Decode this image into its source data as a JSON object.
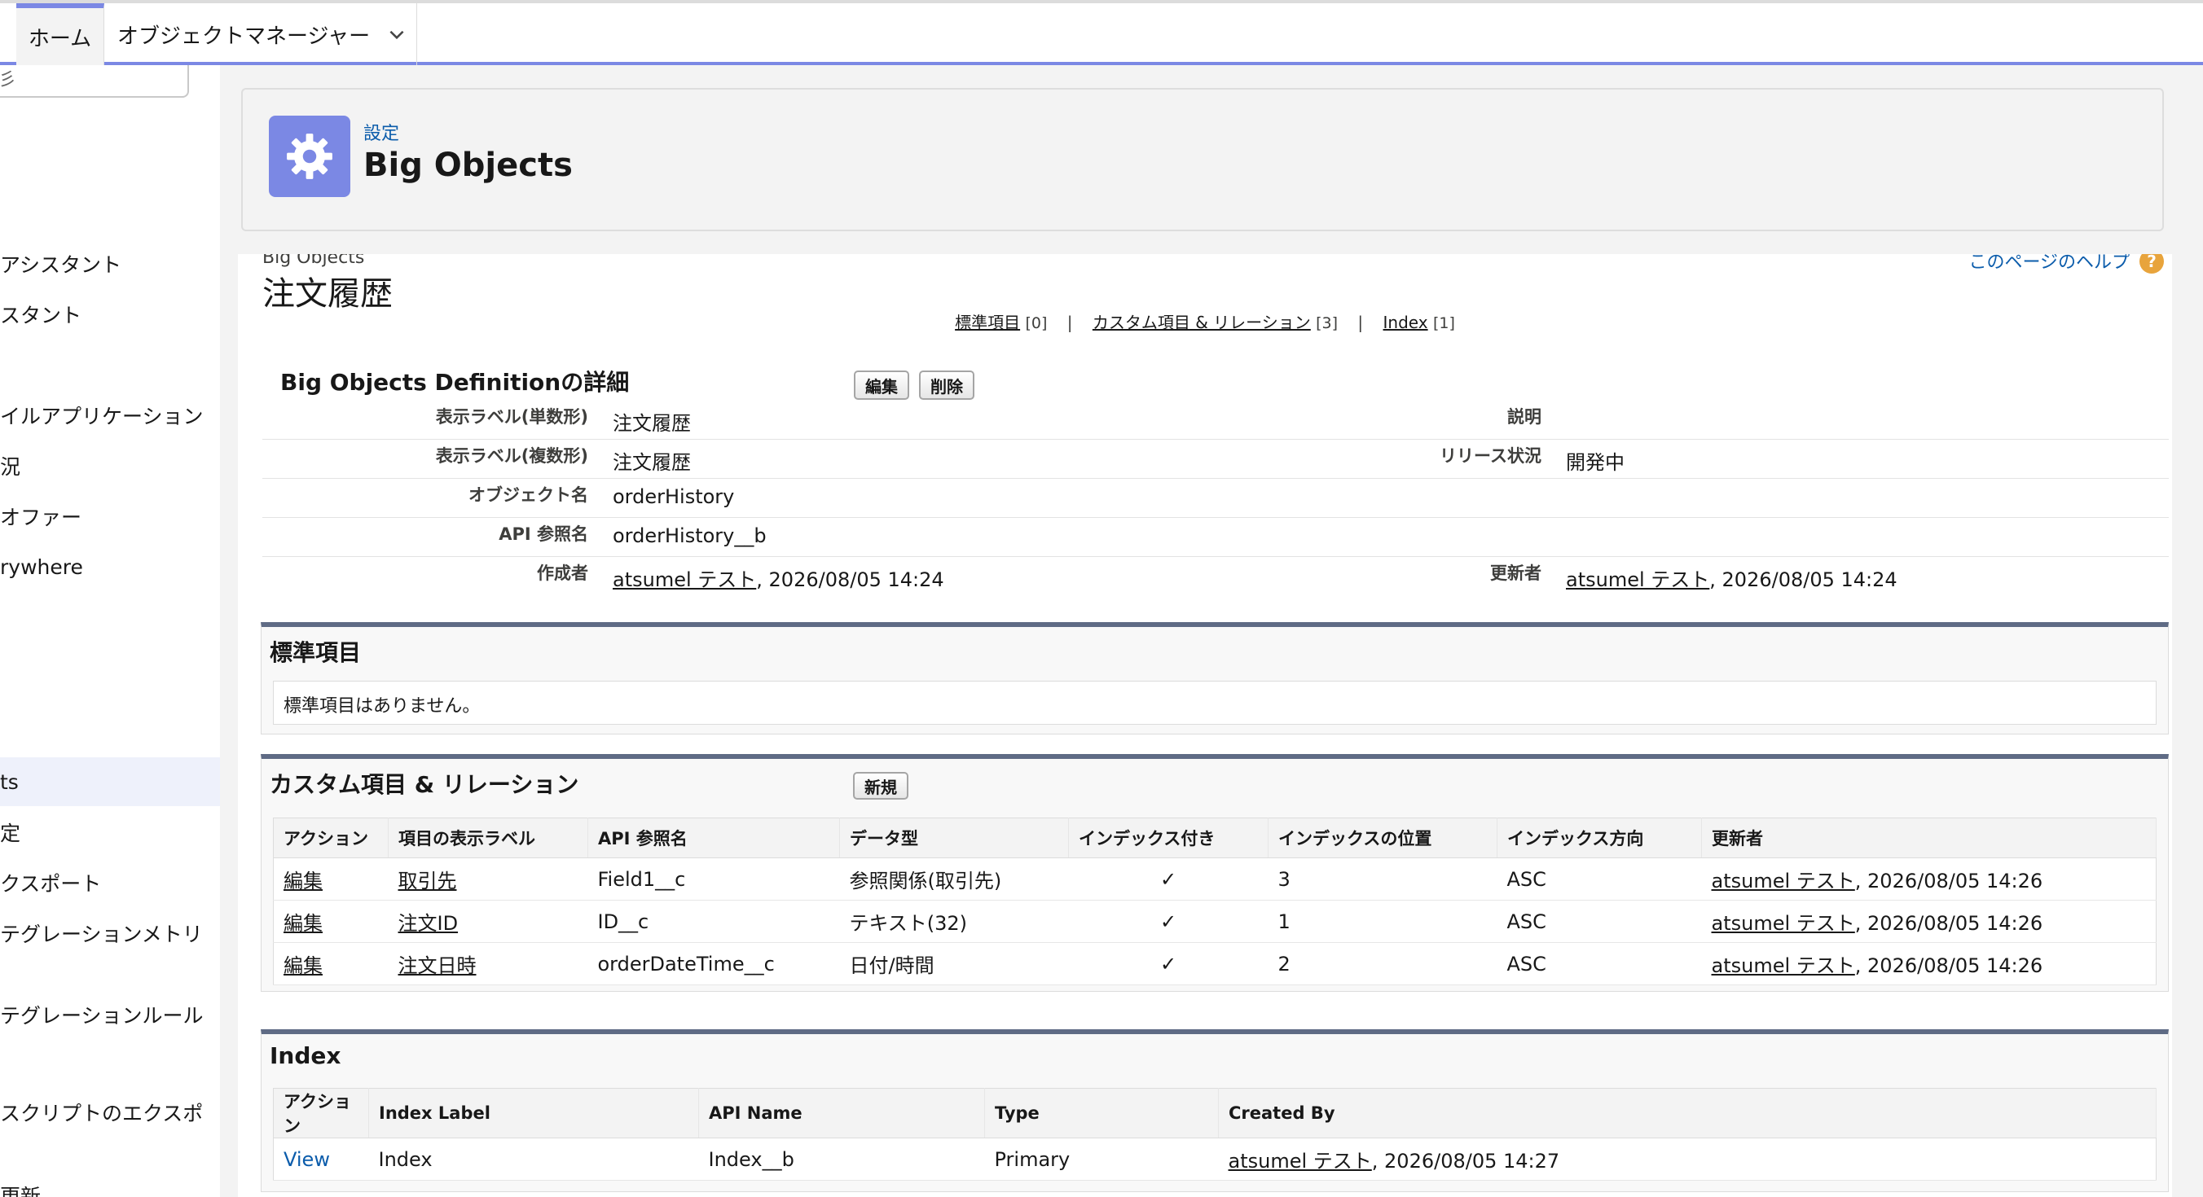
{
  "tabs": {
    "home": "ホーム",
    "object_manager": "オブジェクトマネージャー"
  },
  "sidebar": {
    "search_text": "彡",
    "items": [
      {
        "label": "アシスタント"
      },
      {
        "label": "スタント"
      },
      {
        "label": "イルアプリケーション"
      },
      {
        "label": "況"
      },
      {
        "label": "オファー"
      },
      {
        "label": "rywhere"
      },
      {
        "label": "ts"
      },
      {
        "label": "定"
      },
      {
        "label": "クスポート"
      },
      {
        "label": "テグレーションメトリ"
      },
      {
        "label": "テグレーションルール"
      },
      {
        "label": "スクリプトのエクスポ"
      },
      {
        "label": "更新"
      }
    ]
  },
  "header": {
    "breadcrumb": "設定",
    "title": "Big Objects",
    "icon": "gear-icon",
    "icon_color": "#7b88e4"
  },
  "object": {
    "small_label": "Big Objects",
    "title": "注文履歴",
    "help_link": "このページのヘルプ",
    "related_links": [
      {
        "label": "標準項目",
        "count": "[0]"
      },
      {
        "label": "カスタム項目 & リレーション",
        "count": "[3]"
      },
      {
        "label": "Index",
        "count": "[1]"
      }
    ]
  },
  "detail": {
    "heading": "Big Objects Definitionの詳細",
    "edit_button": "編集",
    "delete_button": "削除",
    "fields": {
      "label_singular": {
        "label": "表示ラベル(単数形)",
        "value": "注文履歴"
      },
      "label_plural": {
        "label": "表示ラベル(複数形)",
        "value": "注文履歴"
      },
      "object_name": {
        "label": "オブジェクト名",
        "value": "orderHistory"
      },
      "api_name": {
        "label": "API 参照名",
        "value": "orderHistory__b"
      },
      "created_by": {
        "label": "作成者",
        "user": "atsumel テスト",
        "date": ", 2026/08/05 14:24"
      },
      "description": {
        "label": "説明",
        "value": ""
      },
      "release_status": {
        "label": "リリース状況",
        "value": "開発中"
      },
      "modified_by": {
        "label": "更新者",
        "user": "atsumel テスト",
        "date": ", 2026/08/05 14:24"
      }
    }
  },
  "standard_fields": {
    "title": "標準項目",
    "empty_message": "標準項目はありません。"
  },
  "custom_fields": {
    "title": "カスタム項目 & リレーション",
    "new_button": "新規",
    "headers": [
      "アクション",
      "項目の表示ラベル",
      "API 参照名",
      "データ型",
      "インデックス付き",
      "インデックスの位置",
      "インデックス方向",
      "更新者"
    ],
    "rows": [
      {
        "action": "編集",
        "label": "取引先",
        "api": "Field1__c",
        "type": "参照関係(取引先)",
        "indexed": "✓",
        "position": "3",
        "direction": "ASC",
        "user": "atsumel テスト",
        "date": ", 2026/08/05 14:26"
      },
      {
        "action": "編集",
        "label": "注文ID",
        "api": "ID__c",
        "type": "テキスト(32)",
        "indexed": "✓",
        "position": "1",
        "direction": "ASC",
        "user": "atsumel テスト",
        "date": ", 2026/08/05 14:26"
      },
      {
        "action": "編集",
        "label": "注文日時",
        "api": "orderDateTime__c",
        "type": "日付/時間",
        "indexed": "✓",
        "position": "2",
        "direction": "ASC",
        "user": "atsumel テスト",
        "date": ", 2026/08/05 14:26"
      }
    ]
  },
  "index_list": {
    "title": "Index",
    "headers": [
      "アクション",
      "Index Label",
      "API Name",
      "Type",
      "Created By"
    ],
    "rows": [
      {
        "action": "View",
        "label": "Index",
        "api": "Index__b",
        "type": "Primary",
        "user": "atsumel テスト",
        "date": ", 2026/08/05 14:27"
      }
    ]
  }
}
